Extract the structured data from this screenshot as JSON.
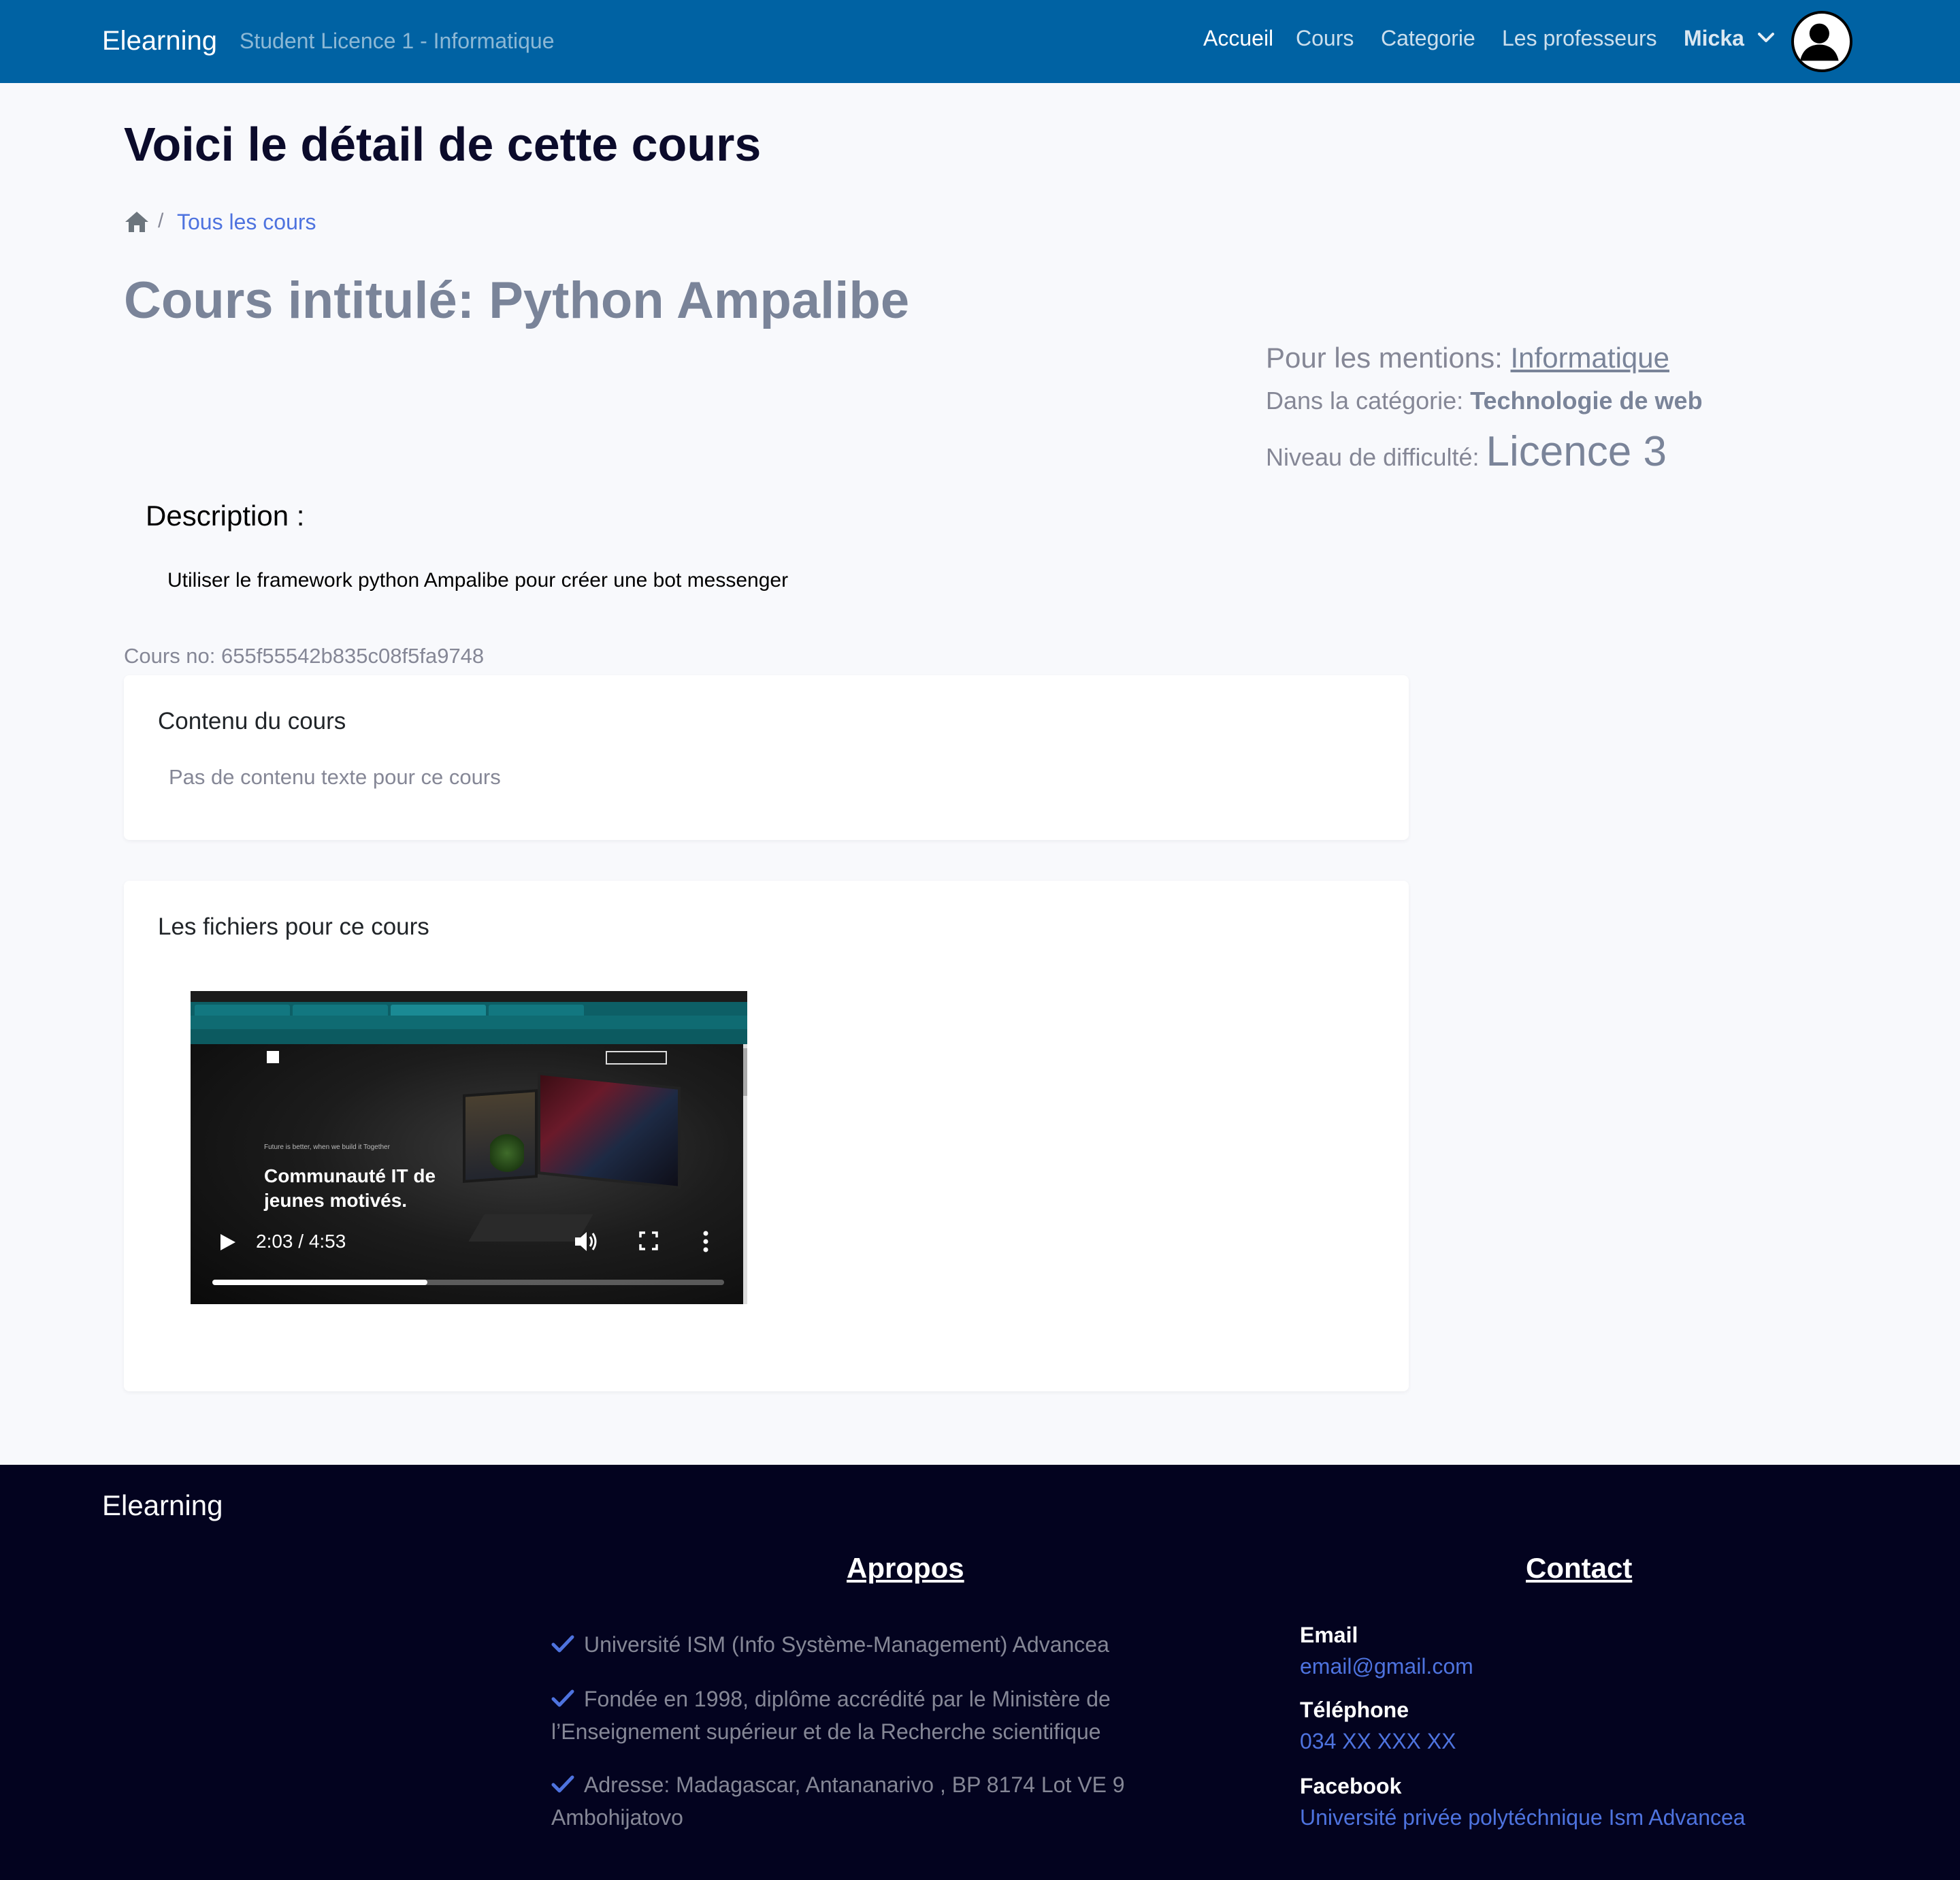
{
  "navbar": {
    "brand": "Elearning",
    "subtitle": "Student Licence 1 - Informatique",
    "links": [
      {
        "label": "Accueil",
        "active": true
      },
      {
        "label": "Cours",
        "active": false
      },
      {
        "label": "Categorie",
        "active": false
      },
      {
        "label": "Les professeurs",
        "active": false
      }
    ],
    "user_name": "Micka",
    "avatar_icon": "user-circle-icon"
  },
  "main": {
    "page_title": "Voici le détail de cette cours",
    "breadcrumb": {
      "home_icon": "home-icon",
      "separator": "/",
      "link": "Tous les cours"
    },
    "course_title": "Cours intitulé: Python Ampalibe",
    "mentions_label": "Pour les mentions:",
    "mentions_value": "Informatique",
    "category_label": "Dans la catégorie:",
    "category_value": "Technologie de web",
    "level_label": "Niveau de difficulté:",
    "level_value": "Licence 3",
    "description_heading": "Description :",
    "description_text": "Utiliser le framework python Ampalibe pour créer une bot messenger",
    "course_no": "Cours no: 655f55542b835c08f5fa9748",
    "content_card": {
      "title": "Contenu du cours",
      "empty_text": "Pas de contenu texte pour ce cours"
    },
    "files_card": {
      "title": "Les fichiers pour ce cours",
      "video": {
        "tagline": "Future is better, when we build it Together",
        "headline_line1": "Communauté IT de",
        "headline_line2": "jeunes motivés.",
        "time": "2:03 / 4:53",
        "progress_fraction": 0.42
      }
    }
  },
  "footer": {
    "brand": "Elearning",
    "apropos_heading": "Apropos",
    "apropos_items": [
      "Université ISM (Info Système-Management) Advancea",
      "Fondée en 1998, diplôme accrédité par le Ministère de l’Enseignement supérieur et de la Recherche scientifique",
      "Adresse: Madagascar, Antananarivo , BP 8174 Lot VE 9 Ambohijatovo"
    ],
    "contact_heading": "Contact",
    "contact": {
      "email_label": "Email",
      "email_value": "email@gmail.com",
      "phone_label": "Téléphone",
      "phone_value": "034 XX XXX XX",
      "facebook_label": "Facebook",
      "facebook_value": "Université privée polytéchnique Ism Advancea"
    }
  },
  "colors": {
    "navbar_bg": "#0062a3",
    "footer_bg": "#03031f",
    "link": "#4e73df",
    "muted": "#858796",
    "check": "#4e73df"
  }
}
